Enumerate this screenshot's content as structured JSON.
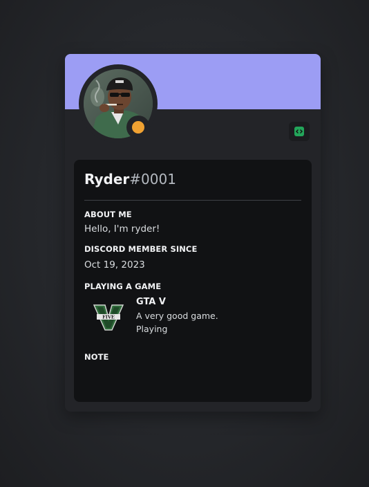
{
  "profile": {
    "username": "Ryder",
    "discriminator": "#0001",
    "status": "idle",
    "colors": {
      "banner": "#9c9df4",
      "status_idle": "#f0a232",
      "badge": "#23a55a"
    }
  },
  "sections": {
    "about_me_title": "ABOUT ME",
    "about_me_text": "Hello, I'm ryder!",
    "member_since_title": "DISCORD MEMBER SINCE",
    "member_since_date": "Oct 19, 2023",
    "activity_title": "PLAYING A GAME",
    "note_title": "NOTE"
  },
  "activity": {
    "game_name": "GTA V",
    "details": "A very good game.",
    "state": "Playing",
    "icon": "gta-v-logo-icon"
  },
  "badge": {
    "icon": "developer-badge-icon"
  }
}
